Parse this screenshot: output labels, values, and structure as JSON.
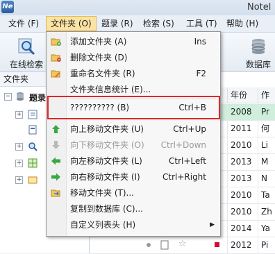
{
  "window": {
    "title": "Notel"
  },
  "menubar": {
    "items": [
      {
        "label": "文件 (F)"
      },
      {
        "label": "文件夹 (O)"
      },
      {
        "label": "题录 (R)"
      },
      {
        "label": "检索 (S)"
      },
      {
        "label": "工具 (T)"
      },
      {
        "label": "帮助 (H)"
      }
    ]
  },
  "ribbon": {
    "online_search": "在线检索",
    "database": "数据库"
  },
  "sidebar": {
    "header": "文件夹",
    "root": "题录"
  },
  "grid": {
    "col_year": "年份",
    "col_author": "作",
    "rows": [
      {
        "year": "2008",
        "author": "Pr"
      },
      {
        "year": "2011",
        "author": "何"
      },
      {
        "year": "2010",
        "author": "Li"
      },
      {
        "year": "2013",
        "author": "M"
      },
      {
        "year": "2013",
        "author": "N"
      },
      {
        "year": "2010",
        "author": "Ta"
      },
      {
        "year": "2010",
        "author": "Zh"
      },
      {
        "year": "2014",
        "author": "Ya"
      },
      {
        "year": "2012",
        "author": "Pi"
      }
    ]
  },
  "folder_menu": {
    "items": [
      {
        "label": "添加文件夹 (A)",
        "shortcut": "Ins",
        "icon": "add-folder-icon"
      },
      {
        "label": "删除文件夹 (D)",
        "shortcut": "",
        "icon": "delete-folder-icon"
      },
      {
        "label": "重命名文件夹 (R)",
        "shortcut": "F2",
        "icon": "rename-icon"
      },
      {
        "label": "文件夹信息统计 (E)...",
        "shortcut": "",
        "icon": ""
      },
      {
        "label": "?????????? (B)",
        "shortcut": "Ctrl+B",
        "icon": ""
      },
      {
        "label": "向上移动文件夹 (U)",
        "shortcut": "Ctrl+Up",
        "icon": "arrow-up-icon"
      },
      {
        "label": "向下移动文件夹 (O)",
        "shortcut": "Ctrl+Down",
        "icon": "arrow-down-icon"
      },
      {
        "label": "向左移动文件夹 (L)",
        "shortcut": "Ctrl+Left",
        "icon": "arrow-left-icon"
      },
      {
        "label": "向右移动文件夹 (I)",
        "shortcut": "Ctrl+Right",
        "icon": "arrow-right-icon"
      },
      {
        "label": "移动文件夹 (T)...",
        "shortcut": "",
        "icon": "move-folder-icon"
      },
      {
        "label": "复制到数据库 (C)...",
        "shortcut": "",
        "icon": ""
      },
      {
        "label": "自定义列表头 (H)",
        "shortcut": "",
        "icon": ""
      }
    ]
  },
  "colors": {
    "highlight_border": "#e0262a",
    "selected_row": "#cfeedb",
    "menu_active": "#fbe3a3"
  }
}
